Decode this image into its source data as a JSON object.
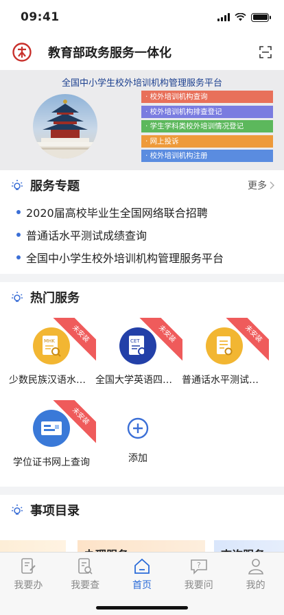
{
  "status": {
    "time": "09:41"
  },
  "header": {
    "title": "教育部政务服务一体化"
  },
  "banner": {
    "title": "全国中小学生校外培训机构管理服务平台",
    "links": [
      {
        "label": "· 校外培训机构查询",
        "color": "#e8705a"
      },
      {
        "label": "· 校外培训机构排查登记",
        "color": "#7a7ce0"
      },
      {
        "label": "· 学生学科类校外培训情况登记",
        "color": "#5cb85c"
      },
      {
        "label": "· 网上投诉",
        "color": "#ee9a3a"
      },
      {
        "label": "· 校外培训机构注册",
        "color": "#5a8ce0"
      }
    ]
  },
  "topics": {
    "title": "服务专题",
    "more": "更多",
    "items": [
      "2020届高校毕业生全国网络联合招聘",
      "普通话水平测试成绩查询",
      "全国中小学生校外培训机构管理服务平台"
    ]
  },
  "hot": {
    "title": "热门服务",
    "ribbon": "未安装",
    "items": [
      {
        "label": "少数民族汉语水平等级考试",
        "icon_text": "MHK",
        "color": "#f2b632"
      },
      {
        "label": "全国大学英语四、六级考试",
        "icon_text": "CET",
        "color": "#2340a8"
      },
      {
        "label": "普通话水平测试成绩查询",
        "icon_text": "",
        "color": "#f2b632"
      },
      {
        "label": "学位证书网上查询",
        "icon_text": "",
        "color": "#3a79d8"
      }
    ],
    "add_label": "添加"
  },
  "catalog": {
    "title": "事项目录",
    "cards": [
      "办理服务",
      "查询服务"
    ]
  },
  "tabs": [
    {
      "label": "我要办",
      "icon": "doc-pen-icon"
    },
    {
      "label": "我要查",
      "icon": "doc-search-icon"
    },
    {
      "label": "首页",
      "icon": "home-icon"
    },
    {
      "label": "我要问",
      "icon": "chat-question-icon"
    },
    {
      "label": "我的",
      "icon": "user-icon"
    }
  ]
}
